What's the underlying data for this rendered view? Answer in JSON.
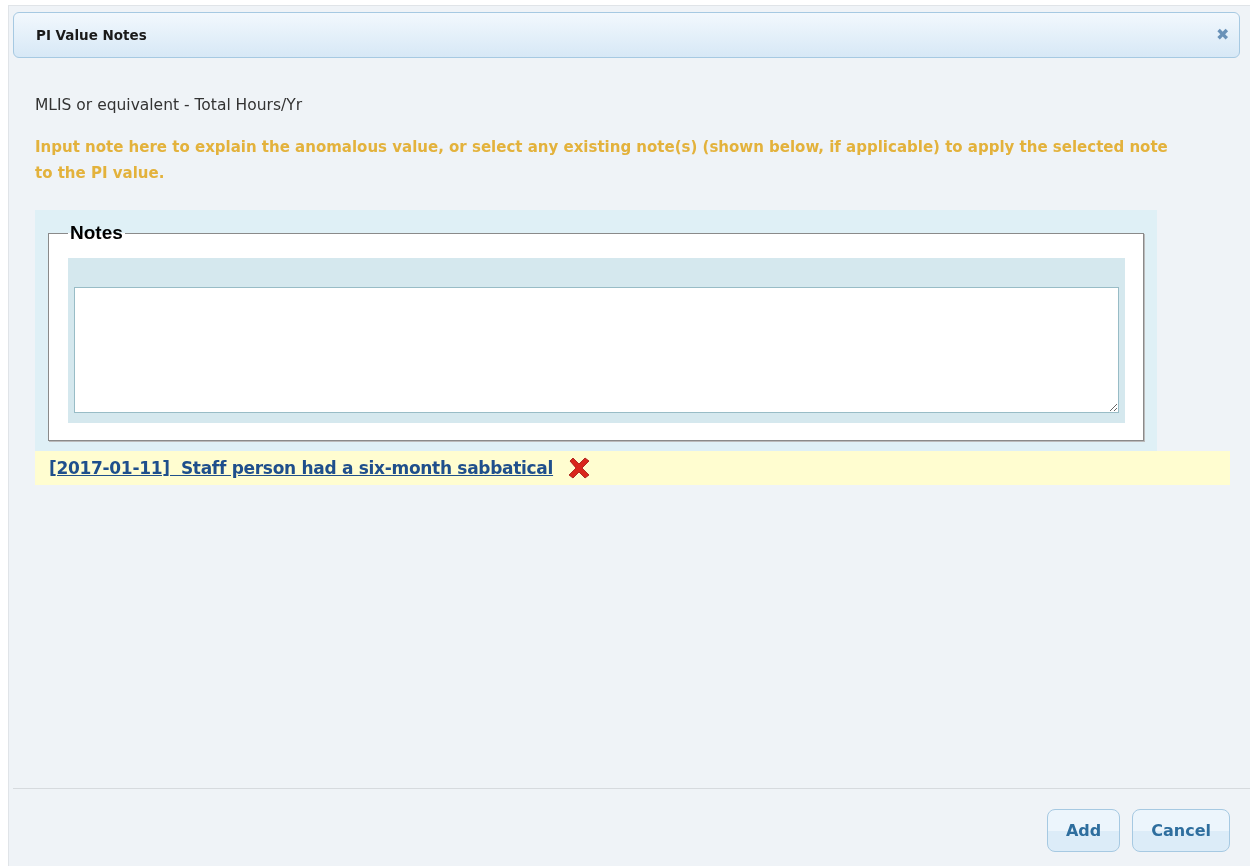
{
  "dialog": {
    "title": "PI Value Notes",
    "close_icon": "✖"
  },
  "measure": "MLIS or equivalent - Total Hours/Yr",
  "instruction": "Input note here to explain the anomalous value, or select any existing note(s) (shown below, if applicable) to apply the selected note to the PI value.",
  "notes": {
    "legend": "Notes"
  },
  "existing_notes": [
    {
      "text": "[2017-01-11]  Staff person had a six-month sabbatical"
    }
  ],
  "buttons": [
    "Add",
    "Cancel"
  ]
}
